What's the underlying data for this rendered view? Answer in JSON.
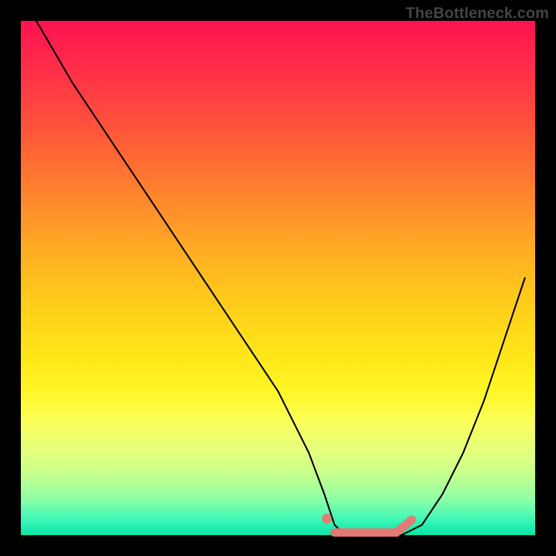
{
  "watermark": "TheBottleneck.com",
  "chart_data": {
    "type": "line",
    "title": "",
    "xlabel": "",
    "ylabel": "",
    "xlim": [
      0,
      100
    ],
    "ylim": [
      0,
      100
    ],
    "grid": false,
    "legend": false,
    "series": [
      {
        "name": "curve",
        "color": "#000000",
        "x": [
          3,
          10,
          18,
          26,
          34,
          42,
          50,
          56,
          59,
          61,
          63,
          66,
          70,
          74,
          78,
          82,
          86,
          90,
          94,
          98
        ],
        "y": [
          100,
          88,
          76,
          64,
          52,
          40,
          28,
          16,
          8,
          2,
          0,
          0,
          0,
          0,
          2,
          8,
          16,
          26,
          38,
          50
        ]
      },
      {
        "name": "marker-dot",
        "color": "#e37a75",
        "x": [
          59.5
        ],
        "y": [
          3.2
        ]
      },
      {
        "name": "flat-highlight",
        "color": "#e37a75",
        "x": [
          61,
          73,
          76
        ],
        "y": [
          0.5,
          0.5,
          3
        ]
      }
    ],
    "background_gradient": {
      "top": "#ff1250",
      "mid": "#ffe81a",
      "bottom": "#06e4a6"
    }
  }
}
